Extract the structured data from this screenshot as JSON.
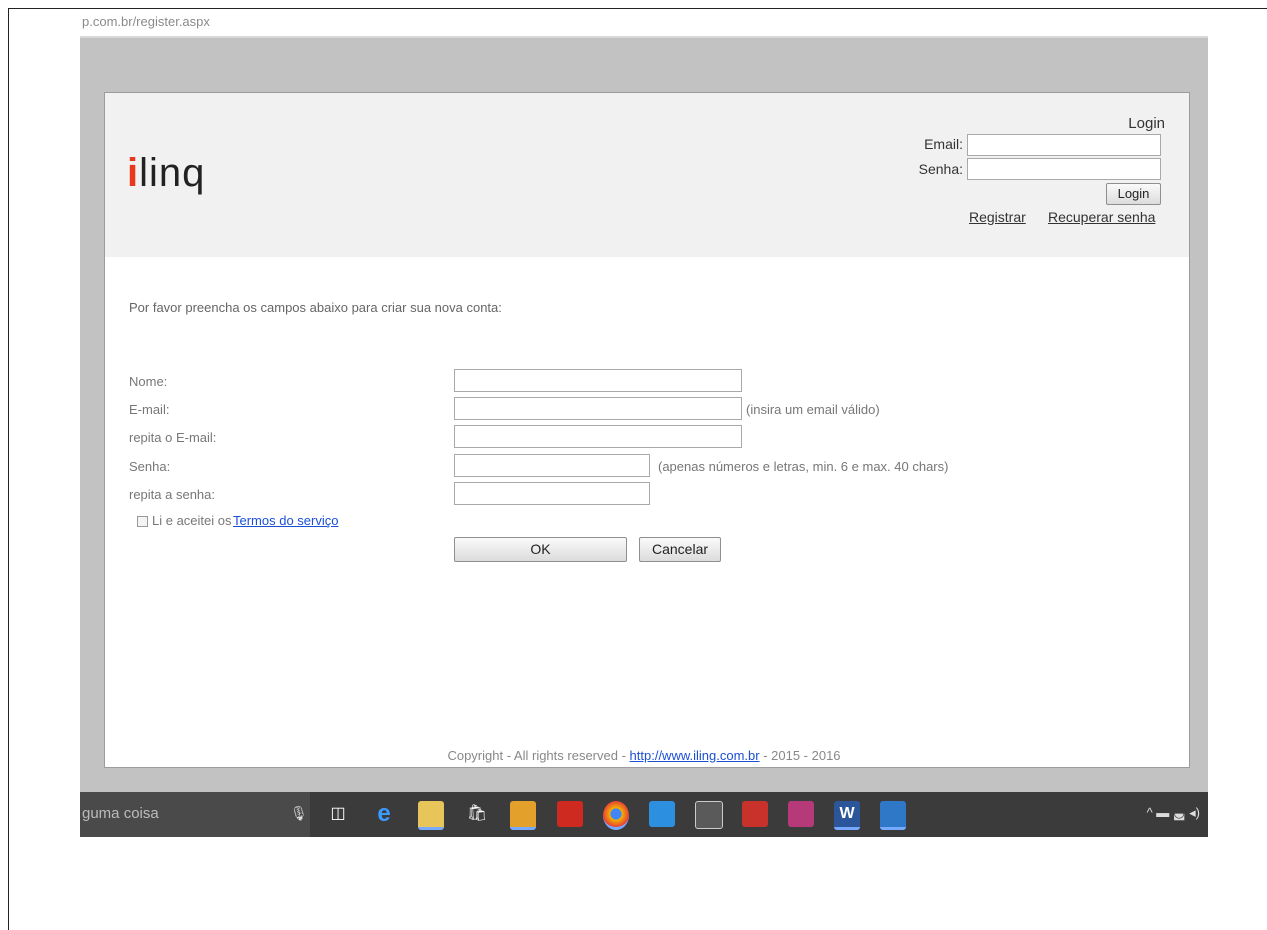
{
  "browser": {
    "url": "p.com.br/register.aspx"
  },
  "header": {
    "logo_i": "i",
    "logo_rest": "linq",
    "login_title": "Login",
    "email_label": "Email:",
    "senha_label": "Senha:",
    "login_button": "Login",
    "register_link": "Registrar",
    "recover_link": "Recuperar senha"
  },
  "form": {
    "intro": "Por favor preencha os campos abaixo para criar sua nova conta:",
    "nome_label": "Nome:",
    "email_label": "E-mail:",
    "email_hint": "(insira um email válido)",
    "email_repeat_label": "repita o E-mail:",
    "senha_label": "Senha:",
    "senha_hint": "(apenas números e letras, min. 6 e max. 40 chars)",
    "senha_repeat_label": "repita a senha:",
    "terms_text": "Li e aceitei os",
    "terms_link": "Termos do serviço",
    "ok_button": "OK",
    "cancel_button": "Cancelar"
  },
  "footer": {
    "prefix": "Copyright - All rights reserved - ",
    "link": "http://www.iling.com.br",
    "suffix": " - 2015 - 2016"
  },
  "taskbar": {
    "search_text": "guma coisa",
    "icons": [
      "mic-icon",
      "task-view-icon",
      "edge-icon",
      "file-explorer-icon",
      "store-icon",
      "outlook-icon",
      "acrobat-icon",
      "chrome-icon",
      "media-player-icon",
      "calculator-icon",
      "app-red-icon",
      "tools-icon",
      "word-icon",
      "image-app-icon"
    ],
    "tray_text": "^ ▬ ◛ ◂)"
  }
}
